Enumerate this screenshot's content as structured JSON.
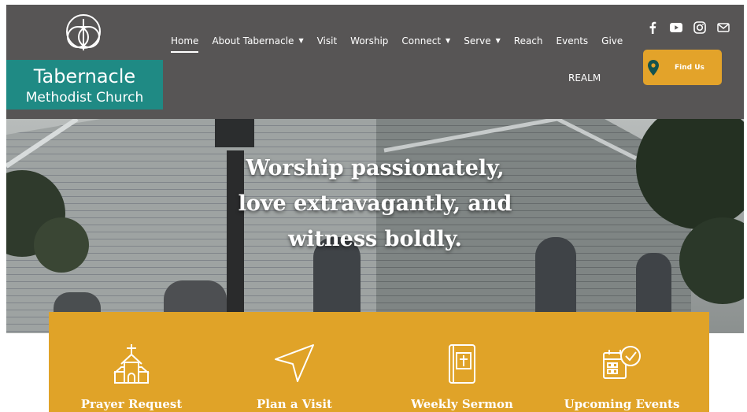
{
  "brand": {
    "line1": "Tabernacle",
    "line2": "Methodist Church",
    "logo_icon": "cross-circles-logo-icon"
  },
  "nav": {
    "items": [
      {
        "label": "Home",
        "active": true,
        "dropdown": false
      },
      {
        "label": "About Tabernacle",
        "active": false,
        "dropdown": true
      },
      {
        "label": "Visit",
        "active": false,
        "dropdown": false
      },
      {
        "label": "Worship",
        "active": false,
        "dropdown": false
      },
      {
        "label": "Connect",
        "active": false,
        "dropdown": true
      },
      {
        "label": "Serve",
        "active": false,
        "dropdown": true
      },
      {
        "label": "Reach",
        "active": false,
        "dropdown": false
      },
      {
        "label": "Events",
        "active": false,
        "dropdown": false
      },
      {
        "label": "Give",
        "active": false,
        "dropdown": false
      }
    ],
    "realm": "REALM"
  },
  "social": [
    "facebook-icon",
    "youtube-icon",
    "instagram-icon",
    "email-icon"
  ],
  "find_us": {
    "label": "Find Us",
    "icon": "map-pin-icon"
  },
  "hero": {
    "line1": "Worship passionately,",
    "line2": "love extravagantly, and",
    "line3": "witness boldly."
  },
  "features": [
    {
      "title": "Prayer Request",
      "icon": "church-icon"
    },
    {
      "title": "Plan a Visit",
      "icon": "send-arrow-icon"
    },
    {
      "title": "Weekly Sermon",
      "icon": "bible-icon"
    },
    {
      "title": "Upcoming Events",
      "icon": "calendar-check-icon"
    }
  ],
  "colors": {
    "header_bg": "#575555",
    "brand_teal": "#1f8a84",
    "accent_gold": "#e0a328",
    "find_us_bg": "#e3a32a",
    "pin_color": "#13524e"
  }
}
